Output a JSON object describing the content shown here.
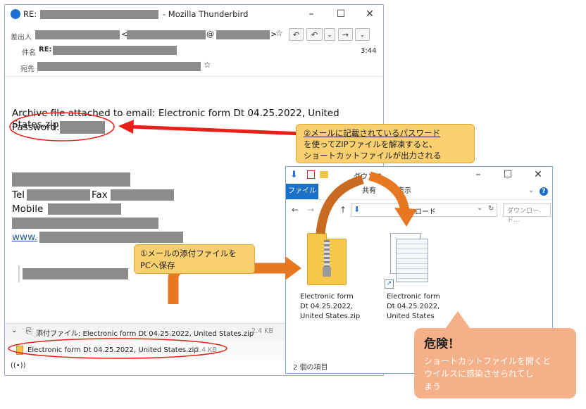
{
  "thunderbird": {
    "title_prefix": "RE:",
    "title_suffix": "- Mozilla Thunderbird",
    "from_label": "差出人",
    "subject_label": "件名",
    "subject_prefix": "RE:",
    "to_label": "宛先",
    "time": "3:44",
    "body_line1": "Archive file attached to email: Electronic form Dt 04.25.2022, United States.zip",
    "password_label": "Password:",
    "tel_label": "Tel",
    "fax_label": "Fax",
    "mobile_label": "Mobile",
    "www_label": "www.",
    "attach_bar": "添付ファイル: Electronic form Dt 04.25.2022, United States.zip",
    "attach_bar_size": "2.4 KB",
    "attach_file": "Electronic form Dt 04.25.2022, United States.zip",
    "attach_file_size": "2.4 KB"
  },
  "explorer": {
    "title": "ダウンロ",
    "tabs": [
      "ファイル",
      "ム",
      "共有",
      "表示"
    ],
    "path": "ウンロード",
    "search_placeholder": "ダウンロード...",
    "items": [
      {
        "name_lines": [
          "Electronic form",
          "Dt 04.25.2022,",
          "United States.zip"
        ]
      },
      {
        "name_lines": [
          "Electronic form",
          "Dt 04.25.2022,",
          "United States"
        ]
      }
    ],
    "status": "2 個の項目"
  },
  "callouts": {
    "step1_lines": [
      "①メールの添付ファイルを",
      "PCへ保存"
    ],
    "step2_lines": [
      "②メールに記載されているパスワード",
      "を使ってZIPファイルを解凍すると、",
      "ショートカットファイルが出力される"
    ],
    "danger_title": "危険！",
    "danger_lines": [
      "ショートカットファイルを開くと",
      "ウイルスに感染させられてし",
      "まう"
    ]
  },
  "colors": {
    "callout_yellow": "#f9cf6f",
    "callout_border": "#e0a830",
    "danger_orange": "#f4b089",
    "arrow_orange": "#e87722",
    "arrow_red": "#e8201a",
    "redaction": "#8c8c8c"
  }
}
